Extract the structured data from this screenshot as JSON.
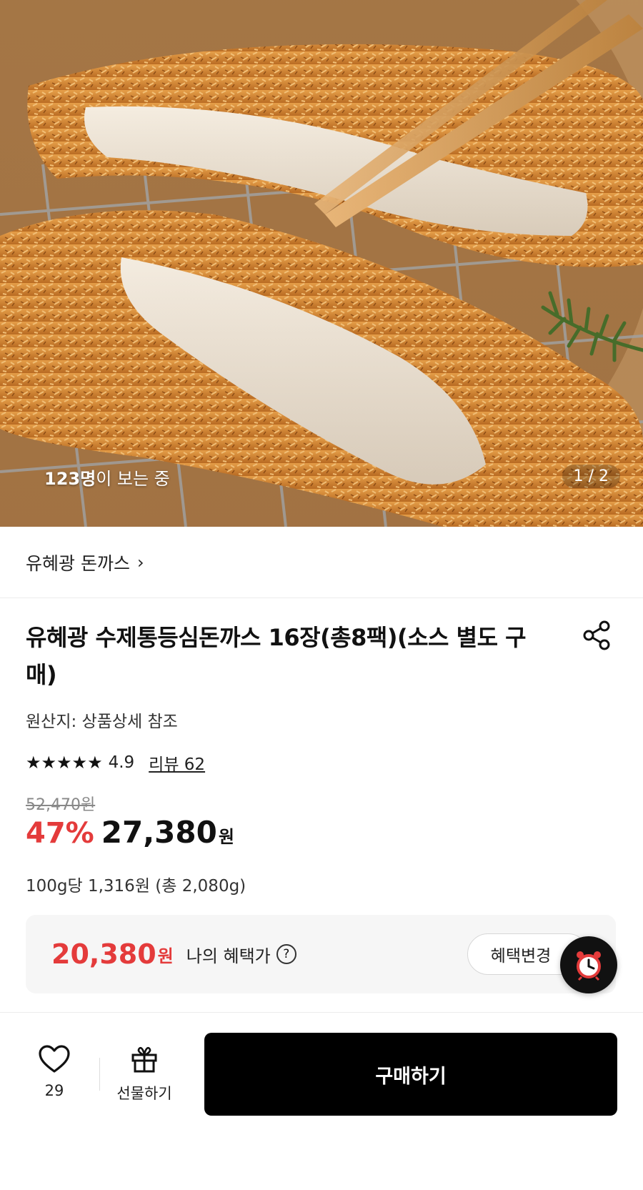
{
  "hero": {
    "viewers_count": "123명",
    "viewers_suffix": "이 보는 중",
    "counter": "1 / 2"
  },
  "brand": {
    "name": "유혜광 돈까스",
    "chevron": "›"
  },
  "product": {
    "title": "유혜광 수제통등심돈까스 16장(총8팩)(소스 별도 구매)",
    "origin": "원산지: 상품상세 참조",
    "rating_stars": "★★★★★",
    "rating": "4.9",
    "review_link": "리뷰 62",
    "original_price": "52,470원",
    "discount": "47%",
    "price": "27,380",
    "price_unit": "원",
    "unit_price": "100g당 1,316원 (총 2,080g)"
  },
  "benefit": {
    "price": "20,380",
    "price_unit": "원",
    "label": "나의 혜택가",
    "help": "?",
    "change_button": "혜택변경"
  },
  "bottom_bar": {
    "wish_count": "29",
    "gift_label": "선물하기",
    "buy_label": "구매하기"
  },
  "icons": {
    "share": "share-icon",
    "heart": "heart-icon",
    "gift": "gift-icon",
    "alarm": "alarm-clock-icon"
  },
  "colors": {
    "accent_red": "#e43b3b",
    "buy_button": "#000000"
  }
}
